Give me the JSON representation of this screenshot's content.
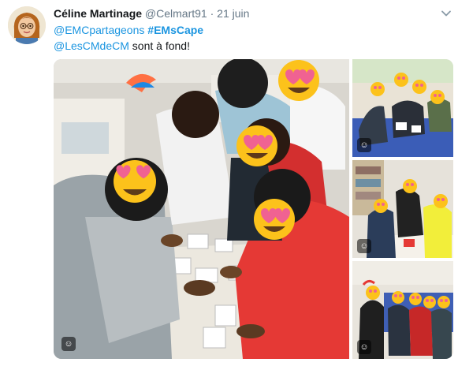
{
  "tweet": {
    "author_name": "Céline Martinage",
    "author_handle": "@Celmart91",
    "separator": "·",
    "timestamp": "21 juin",
    "text": {
      "mention_1": "@EMCpartageons",
      "hashtag": "#EMsCape",
      "mention_2": "@LesCMdeCM",
      "tail": " sont à fond!"
    }
  },
  "media": {
    "badge_glyph": "☺",
    "photos": [
      "classroom-group-main",
      "classroom-group-1",
      "classroom-group-2",
      "classroom-group-3"
    ]
  },
  "icons": {
    "avatar": "avatar-cartoon",
    "more": "chevron-down-icon",
    "face_overlay": "heart-eyes-emoji-icon"
  },
  "colors": {
    "link": "#1b95e0",
    "text": "#14171a",
    "secondary": "#657786"
  }
}
